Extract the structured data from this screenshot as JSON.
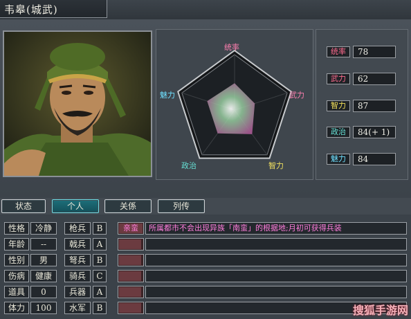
{
  "title": "韦皋(城武)",
  "radar": {
    "labels": {
      "tong": "统率",
      "wu": "武力",
      "zhi": "智力",
      "zheng": "政治",
      "mei": "魅力"
    },
    "max": 100
  },
  "stats": [
    {
      "label": "统率",
      "value": "78",
      "num": 78,
      "label_color": "#ff6b8e"
    },
    {
      "label": "武力",
      "value": "62",
      "num": 62,
      "label_color": "#ff6b8e"
    },
    {
      "label": "智力",
      "value": "87",
      "num": 87,
      "label_color": "#f2e05a"
    },
    {
      "label": "政治",
      "value": "84(+ 1)",
      "num": 84,
      "label_color": "#66e0d4"
    },
    {
      "label": "魅力",
      "value": "84",
      "num": 84,
      "label_color": "#6fe0ff"
    }
  ],
  "tabs": [
    {
      "label": "状态",
      "active": false
    },
    {
      "label": "个人",
      "active": true
    },
    {
      "label": "关係",
      "active": false
    },
    {
      "label": "列传",
      "active": false
    }
  ],
  "personal": [
    {
      "label": "性格",
      "value": "冷静"
    },
    {
      "label": "年龄",
      "value": "--"
    },
    {
      "label": "性别",
      "value": "男"
    },
    {
      "label": "伤病",
      "value": "健康"
    },
    {
      "label": "道具",
      "value": "0"
    },
    {
      "label": "体力",
      "value": "100"
    }
  ],
  "aptitude": [
    {
      "label": "枪兵",
      "grade": "B"
    },
    {
      "label": "戟兵",
      "grade": "A"
    },
    {
      "label": "弩兵",
      "grade": "B"
    },
    {
      "label": "骑兵",
      "grade": "C"
    },
    {
      "label": "兵器",
      "grade": "A"
    },
    {
      "label": "水军",
      "grade": "B"
    }
  ],
  "skills": [
    {
      "name": "亲蛮",
      "desc": "所属都市不会出现异族「南蛮」的根据地;月初可获得兵装",
      "level": 1.0
    },
    {
      "name": "",
      "desc": "",
      "level": 0.95
    },
    {
      "name": "",
      "desc": "",
      "level": 0.95
    },
    {
      "name": "",
      "desc": "",
      "level": 0.95
    },
    {
      "name": "",
      "desc": "",
      "level": 0.95
    },
    {
      "name": "",
      "desc": "",
      "level": 0.95
    }
  ],
  "watermark": "搜狐手游网",
  "colors": {
    "accent_tab": "#1d6f7a",
    "skill_text": "#ff7ddc",
    "radar_label": "#ff7fb0"
  }
}
